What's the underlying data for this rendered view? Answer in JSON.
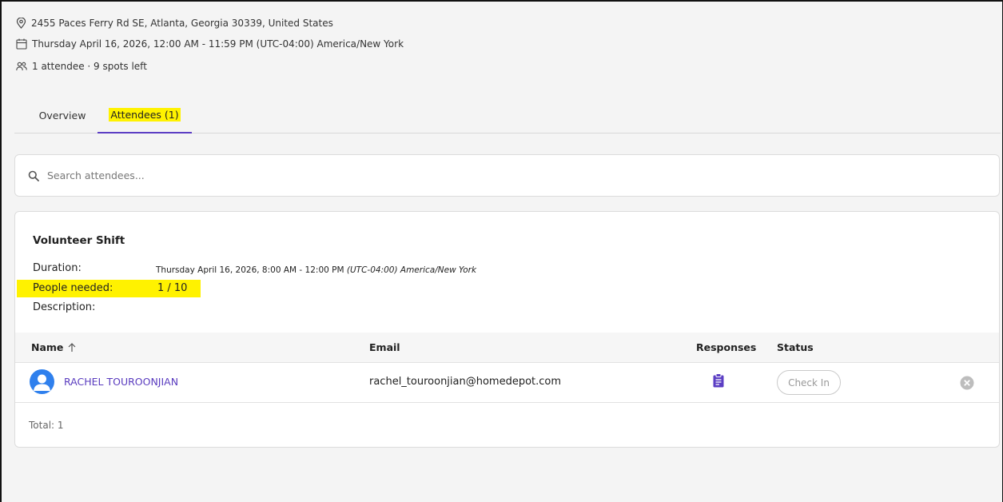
{
  "event": {
    "address": "2455 Paces Ferry Rd SE, Atlanta, Georgia 30339, United States",
    "datetime": "Thursday April 16, 2026, 12:00 AM - 11:59 PM (UTC-04:00) America/New York",
    "attendance": "1 attendee · 9 spots left"
  },
  "tabs": [
    {
      "label": "Overview"
    },
    {
      "label": "Attendees (1)"
    }
  ],
  "search": {
    "placeholder": "Search attendees..."
  },
  "shift": {
    "title": "Volunteer Shift",
    "duration_label": "Duration:",
    "duration_value": "Thursday April 16, 2026, 8:00 AM - 12:00 PM",
    "duration_tz": "(UTC-04:00) America/New York",
    "people_label": "People needed:",
    "people_value": "1 / 10",
    "description_label": "Description:"
  },
  "table": {
    "columns": {
      "name": "Name",
      "email": "Email",
      "responses": "Responses",
      "status": "Status"
    },
    "sort_icon": "arrow-up-icon",
    "rows": [
      {
        "name": "RACHEL TOUROONJIAN",
        "email": "rachel_touroonjian@homedepot.com",
        "status_button": "Check In"
      }
    ],
    "total": "Total: 1"
  },
  "colors": {
    "accent": "#5c3fc4",
    "link": "#5a3cbf",
    "highlight": "#fff200",
    "avatar": "#2f80ed"
  }
}
